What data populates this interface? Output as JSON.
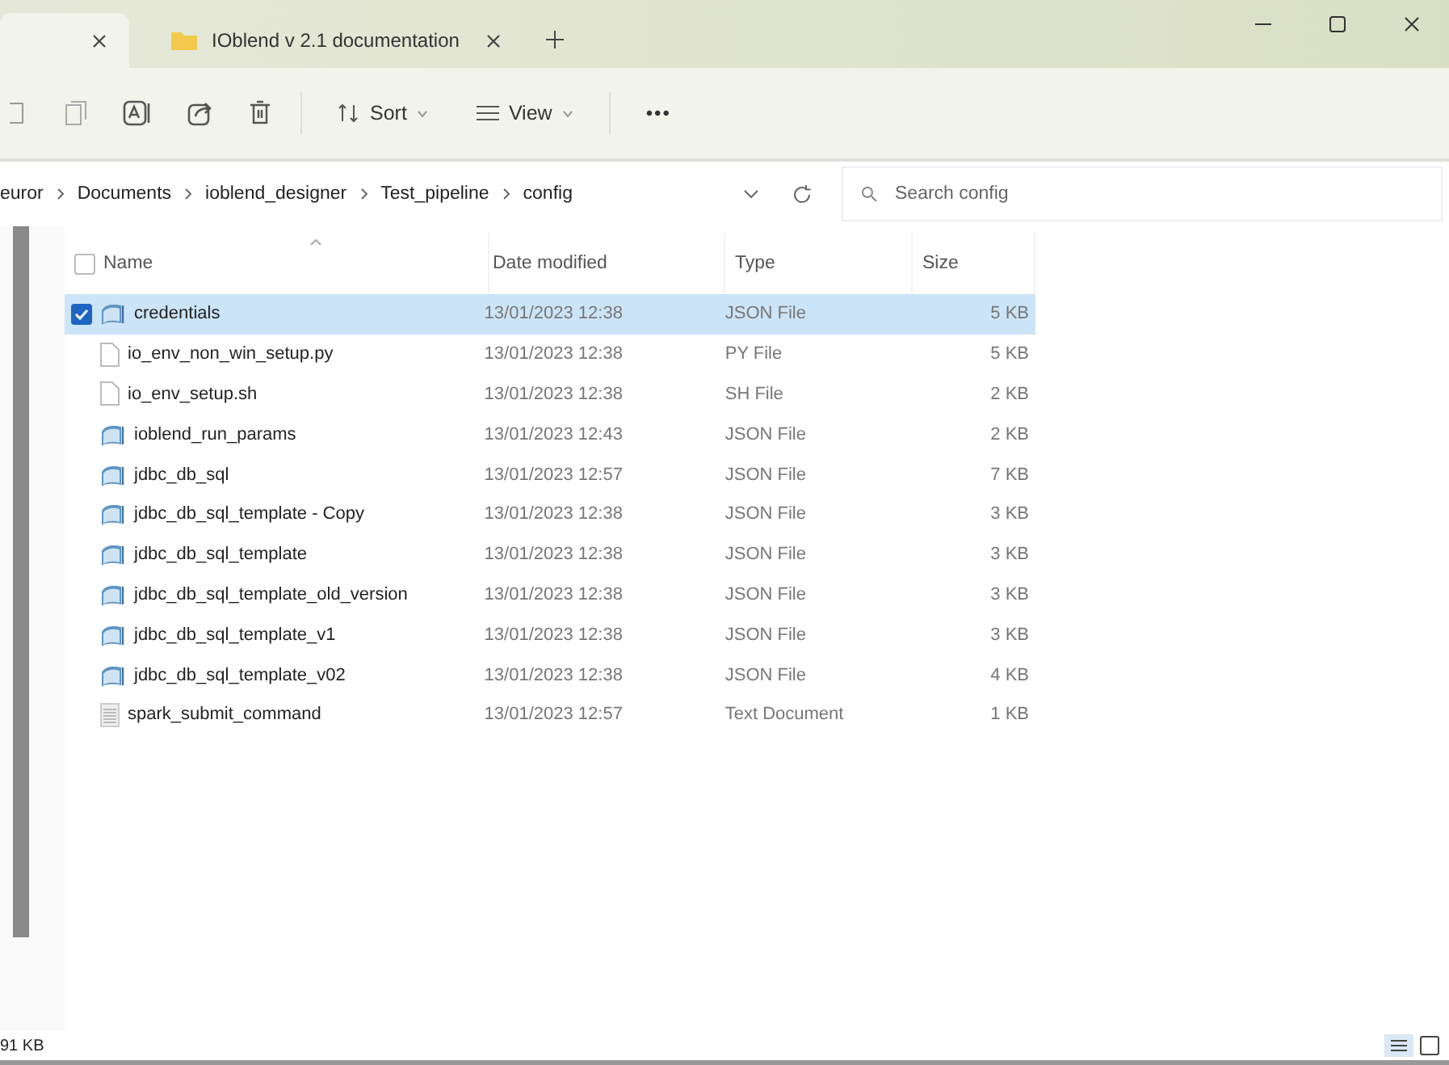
{
  "tabs": [
    {
      "selected": true
    },
    {
      "label": "IOblend v 2.1 documentation",
      "selected": false
    }
  ],
  "toolbar": {
    "sort": "Sort",
    "view": "View",
    "more": "•••"
  },
  "address": {
    "crumbs": [
      "euror",
      "Documents",
      "ioblend_designer",
      "Test_pipeline",
      "config"
    ],
    "search_placeholder": "Search config"
  },
  "columns": [
    "Name",
    "Date modified",
    "Type",
    "Size"
  ],
  "select_all_checked": false,
  "rows": [
    {
      "name": "credentials",
      "date": "13/01/2023 12:38",
      "type": "JSON File",
      "size": "5 KB",
      "kind": "json",
      "selected": true
    },
    {
      "name": "io_env_non_win_setup.py",
      "date": "13/01/2023 12:38",
      "type": "PY File",
      "size": "5 KB",
      "kind": "file",
      "selected": false
    },
    {
      "name": "io_env_setup.sh",
      "date": "13/01/2023 12:38",
      "type": "SH File",
      "size": "2 KB",
      "kind": "file",
      "selected": false
    },
    {
      "name": "ioblend_run_params",
      "date": "13/01/2023 12:43",
      "type": "JSON File",
      "size": "2 KB",
      "kind": "json",
      "selected": false
    },
    {
      "name": "jdbc_db_sql",
      "date": "13/01/2023 12:57",
      "type": "JSON File",
      "size": "7 KB",
      "kind": "json",
      "selected": false
    },
    {
      "name": "jdbc_db_sql_template - Copy",
      "date": "13/01/2023 12:38",
      "type": "JSON File",
      "size": "3 KB",
      "kind": "json",
      "selected": false
    },
    {
      "name": "jdbc_db_sql_template",
      "date": "13/01/2023 12:38",
      "type": "JSON File",
      "size": "3 KB",
      "kind": "json",
      "selected": false
    },
    {
      "name": "jdbc_db_sql_template_old_version",
      "date": "13/01/2023 12:38",
      "type": "JSON File",
      "size": "3 KB",
      "kind": "json",
      "selected": false
    },
    {
      "name": "jdbc_db_sql_template_v1",
      "date": "13/01/2023 12:38",
      "type": "JSON File",
      "size": "3 KB",
      "kind": "json",
      "selected": false
    },
    {
      "name": "jdbc_db_sql_template_v02",
      "date": "13/01/2023 12:38",
      "type": "JSON File",
      "size": "4 KB",
      "kind": "json",
      "selected": false
    },
    {
      "name": "spark_submit_command",
      "date": "13/01/2023 12:57",
      "type": "Text Document",
      "size": "1 KB",
      "kind": "text",
      "selected": false
    }
  ],
  "status_bar": {
    "size": "91 KB"
  }
}
